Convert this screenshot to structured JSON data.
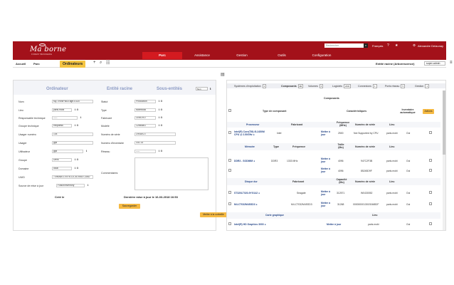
{
  "header": {
    "logo_text": "Ma borne",
    "logo_sub": "FOREST BRASSERIE",
    "search_placeholder": "Rechercher",
    "language": "Français",
    "help_icon": "?",
    "star_icon": "★",
    "user_name": "Alexandre Delaunay",
    "power_icon": "⏻"
  },
  "nav": {
    "items": [
      {
        "label": "Parc",
        "active": true
      },
      {
        "label": "Assistance",
        "active": false
      },
      {
        "label": "Gestion",
        "active": false
      },
      {
        "label": "Outils",
        "active": false
      },
      {
        "label": "Configuration",
        "active": false
      }
    ]
  },
  "breadcrumb": {
    "home": "Accueil",
    "parc": "Parc",
    "current": "Ordinateurs",
    "entity_label": "Entité racine (Arborescence)",
    "profile": "super-admin"
  },
  "left": {
    "tabs": [
      "Ordinateur",
      "Entité racine",
      "Sous-entités"
    ],
    "nav_select": "Non",
    "fields": {
      "nom_label": "Nom",
      "nom_value": "My-ThinkPad-Edge-E320",
      "lieu_label": "Lieu",
      "lieu_value": "paris.mobi",
      "resp_label": "Responsable technique",
      "resp_value": "-----",
      "groupe_tech_label": "Groupe technique",
      "groupe_tech_value": "Helpdesk",
      "usager_num_label": "Usager numéro",
      "usager_num_value": "104",
      "usager_label": "Usager",
      "usager_value": "glpi",
      "utilisateur_label": "Utilisateur",
      "utilisateur_value": "glpi",
      "groupe_label": "Groupe",
      "groupe_value": "Devs",
      "domaine_label": "Domaine",
      "domaine_value": "local",
      "uuid_label": "UUID",
      "uuid_value": "7298A801-007B-11CB-0553-CD6D",
      "source_label": "Source de mise à jour",
      "source_value": "FusionInventory",
      "statut_label": "Statut",
      "statut_value": "Production",
      "type_label": "Type",
      "type_value": "Notebook",
      "fabricant_label": "Fabricant",
      "fabricant_value": "LENOVO",
      "modele_label": "Modèle",
      "modele_value": "1298A8G",
      "serie_label": "Numéro de série",
      "serie_value": "LR0AKZ7",
      "inventaire_label": "Numéro d'inventaire",
      "inventaire_value": "331-14",
      "reseau_label": "Réseau",
      "reseau_value": "-----",
      "comment_label": "Commentaires"
    },
    "created": "Créé le",
    "updated": "Dernière mise à jour le 16-03-2018 16:53",
    "save_label": "Sauvegarder",
    "trash_label": "Mettre à la corbeille"
  },
  "right": {
    "tabs": [
      {
        "label": "Systèmes d'exploitation",
        "badge": "1"
      },
      {
        "label": "Composants",
        "badge": "29",
        "active": true
      },
      {
        "label": "Volumes",
        "badge": "4"
      },
      {
        "label": "Logiciels",
        "badge": "2600"
      },
      {
        "label": "Connexions",
        "badge": "1"
      },
      {
        "label": "Ports réseau",
        "badge": "5"
      },
      {
        "label": "Gestion",
        "badge": "1"
      }
    ],
    "section_title": "Composants",
    "col_type": "Type de composant",
    "col_chars": "Caractéristiques",
    "col_inventaire": "Inventaire automatique",
    "actions_label": "Actions",
    "proc_header": {
      "name": "Processeur",
      "fab": "Fabricant",
      "freq": "Fréquence (MHz)",
      "serie": "Numéro de série",
      "lieu": "Lieu"
    },
    "proc_row": {
      "name": "Intel(R) Core(TM) i5-2450M CPU @ 2.50GHz ●",
      "fab": "Intel",
      "action": "Mettre à jour",
      "freq": "2500",
      "serie": "Not Supported by CPU",
      "lieu": "paris.mobi",
      "auto": "Oui"
    },
    "mem_header": {
      "name": "Mémoire",
      "type": "Type",
      "freq": "Fréquence",
      "taille": "Taille (Mo)",
      "serie": "Numéro de série",
      "lieu": "Lieu"
    },
    "mem_rows": [
      {
        "name": "DDR3 - SODIMM ●",
        "type": "DDR3",
        "freq": "1333 MHz",
        "action": "Mettre à jour",
        "taille": "4096",
        "serie": "947C2F3B",
        "lieu": "paris.mobi",
        "auto": "Oui"
      },
      {
        "action": "Mettre à jour",
        "taille": "4096",
        "serie": "85245D9F",
        "lieu": "paris.mobi",
        "auto": "Oui"
      }
    ],
    "disk_header": {
      "name": "Disque dur",
      "fab": "Fabricant",
      "cap": "Capacité (Mo)",
      "serie": "Numéro de série",
      "lieu": "Lieu"
    },
    "disk_rows": [
      {
        "name": "ST320LT020-9YG142 ●",
        "fab": "Seagate",
        "action": "Mettre à jour",
        "cap": "312571",
        "serie": "W0430052",
        "lieu": "paris.mobi",
        "auto": "Oui"
      },
      {
        "name": "M4-CT032M4SSD3 ●",
        "fab": "M4-CT032M4SSD3",
        "action": "Mettre à jour",
        "cap": "31268",
        "serie": "0000000013019246B2F",
        "lieu": "paris.mobi",
        "auto": "Oui"
      }
    ],
    "gfx_header": {
      "name": "Carte graphique",
      "lieu": "Lieu"
    },
    "gfx_row": {
      "name": "Intel(R) HD Graphics 3000 ●",
      "action": "Mettre à jour",
      "lieu": "paris.mobi",
      "auto": "Oui"
    }
  }
}
